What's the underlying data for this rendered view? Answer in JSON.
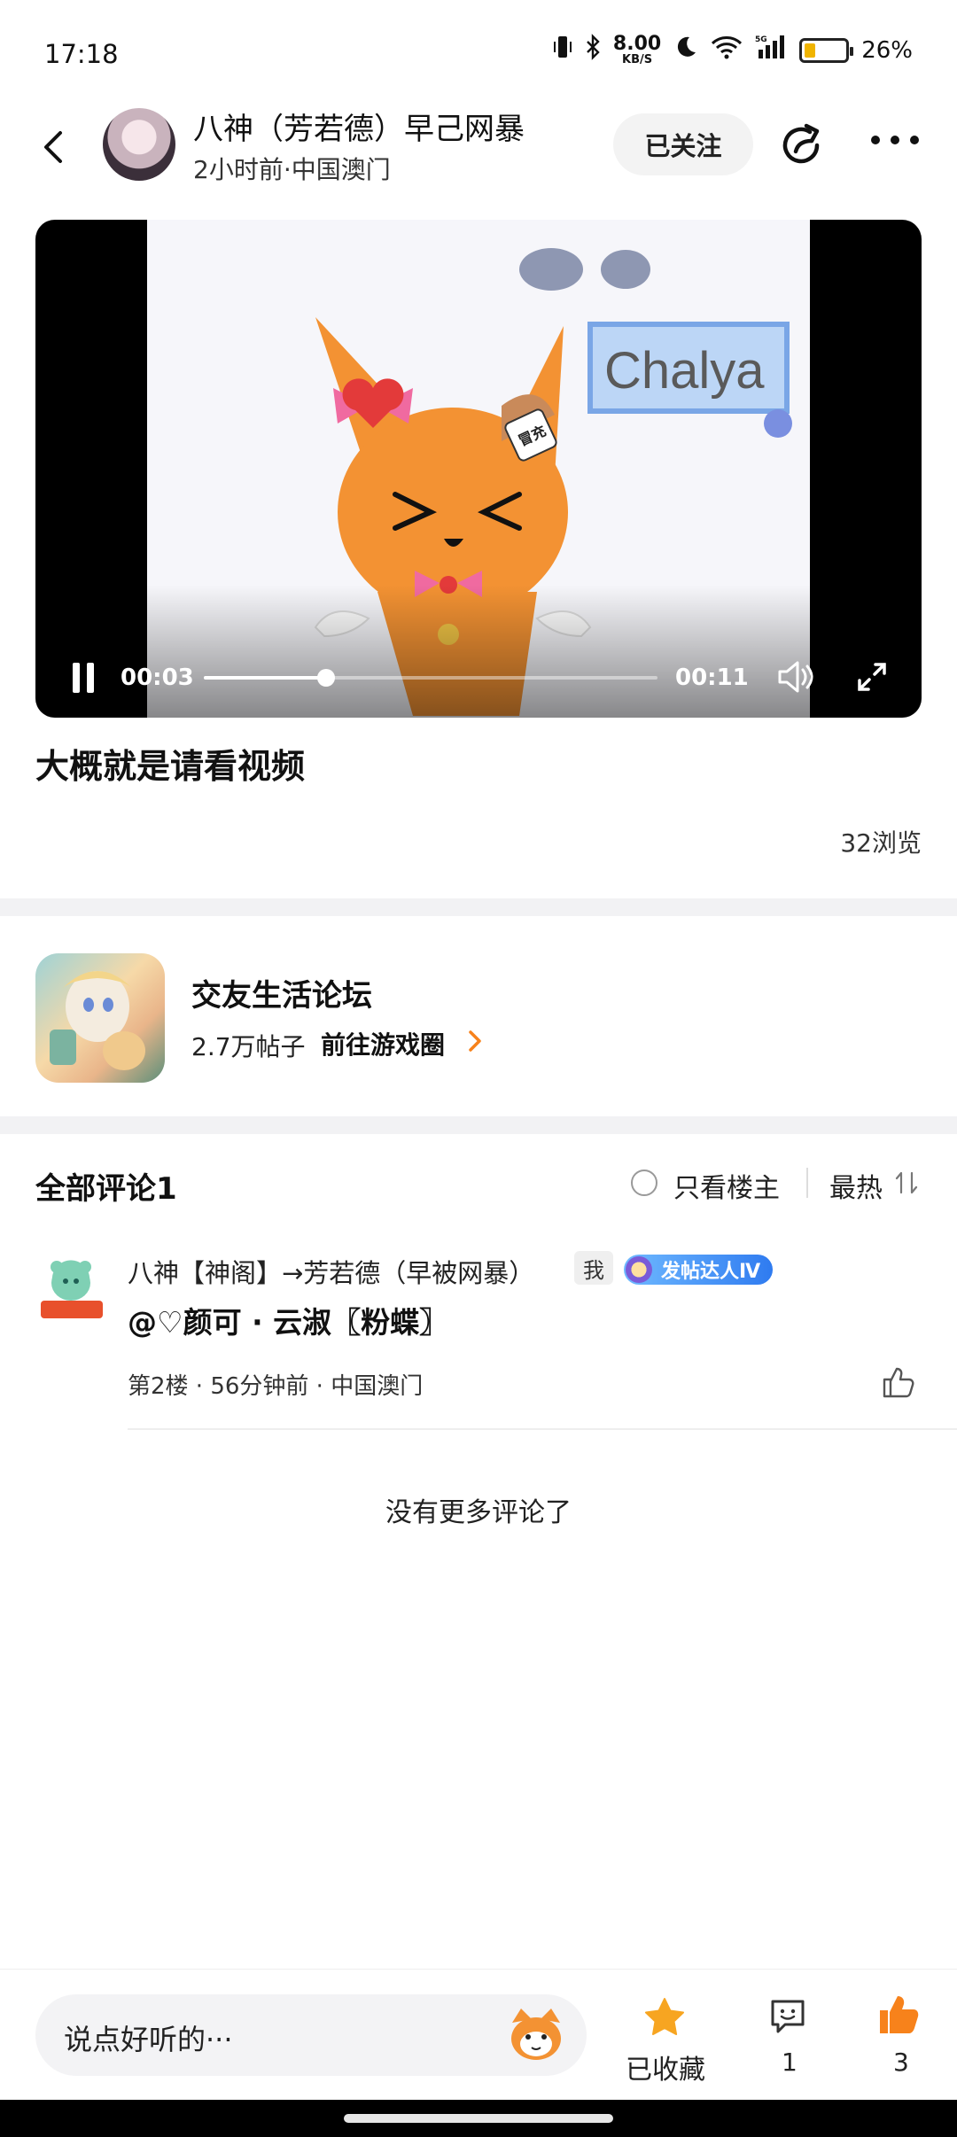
{
  "status_bar": {
    "time": "17:18",
    "net_speed": "8.00",
    "net_unit": "KB/S",
    "battery": "26%",
    "battery_level": 0.26
  },
  "header": {
    "user_name": "八神（芳若德）早己网暴",
    "meta": "2小时前·中国澳门",
    "follow_label": "已关注"
  },
  "video": {
    "current_time": "00:03",
    "total_time": "00:11",
    "progress": 0.27,
    "overlay_text": "Chalya",
    "tag_text": "冒充"
  },
  "post": {
    "title": "大概就是请看视频",
    "views": "32浏览"
  },
  "forum": {
    "name": "交友生活论坛",
    "posts": "2.7万帖子",
    "link_label": "前往游戏圈"
  },
  "comments": {
    "title": "全部评论1",
    "only_op_label": "只看楼主",
    "sort_label": "最热",
    "items": [
      {
        "name": "八神【神阁】→芳若德（早被网暴）",
        "me_tag": "我",
        "badge": "发帖达人Ⅳ",
        "text": "@♡颜可 · 云淑〖粉蝶〗",
        "meta": "第2楼 · 56分钟前 · 中国澳门"
      }
    ],
    "no_more": "没有更多评论了"
  },
  "bottom_bar": {
    "input_placeholder": "说点好听的···",
    "fav_label": "已收藏",
    "comment_count": "1",
    "like_count": "3"
  },
  "colors": {
    "accent_orange": "#f7a521",
    "like_orange": "#f7821b",
    "badge_blue": "#2f7bf0"
  }
}
